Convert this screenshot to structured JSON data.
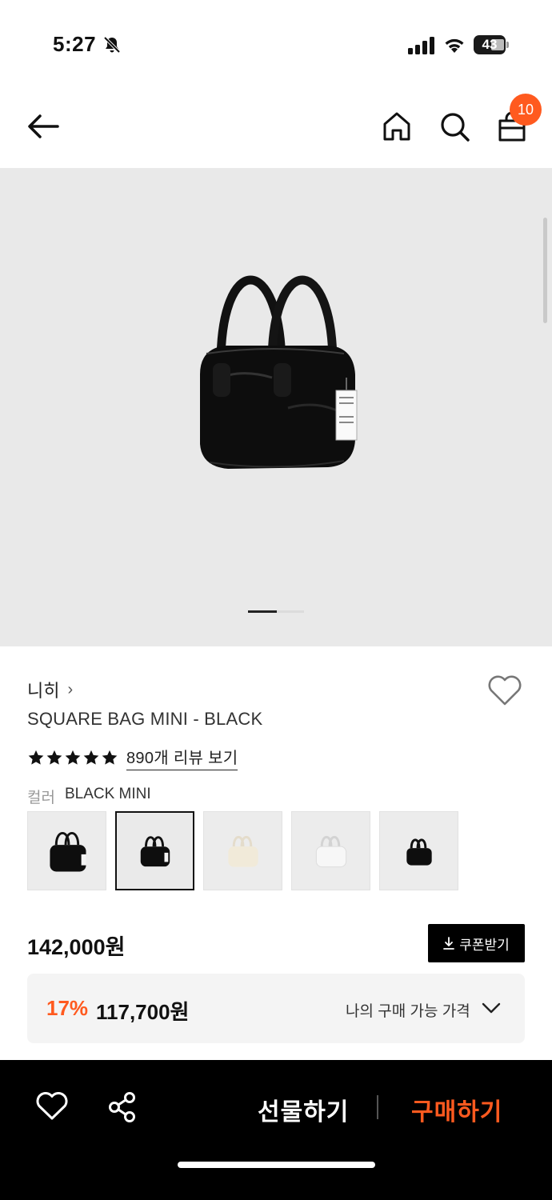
{
  "status_bar": {
    "time": "5:27",
    "battery": "43"
  },
  "nav": {
    "cart_count": "10"
  },
  "product": {
    "brand": "니히",
    "brand_chevron": "›",
    "name": "SQUARE BAG MINI - BLACK",
    "rating": 5,
    "review_link": "890개 리뷰 보기",
    "color_label": "컬러",
    "color_value": "BLACK MINI",
    "swatches": [
      {
        "color": "black",
        "selected": false
      },
      {
        "color": "black",
        "selected": true
      },
      {
        "color": "cream",
        "selected": false
      },
      {
        "color": "white",
        "selected": false
      },
      {
        "color": "black",
        "selected": false
      }
    ],
    "image_pager": {
      "current": 1,
      "total": 2
    }
  },
  "price": {
    "original": "142,000원",
    "coupon_label": "쿠폰받기",
    "discount_rate": "17%",
    "discount_price": "117,700원",
    "discount_note": "나의 구매 가능 가격"
  },
  "bottom_bar": {
    "gift_label": "선물하기",
    "buy_label": "구매하기"
  },
  "colors": {
    "accent": "#ff5a1f",
    "image_bg": "#e9e9e9",
    "bottom_bar": "#000000"
  }
}
